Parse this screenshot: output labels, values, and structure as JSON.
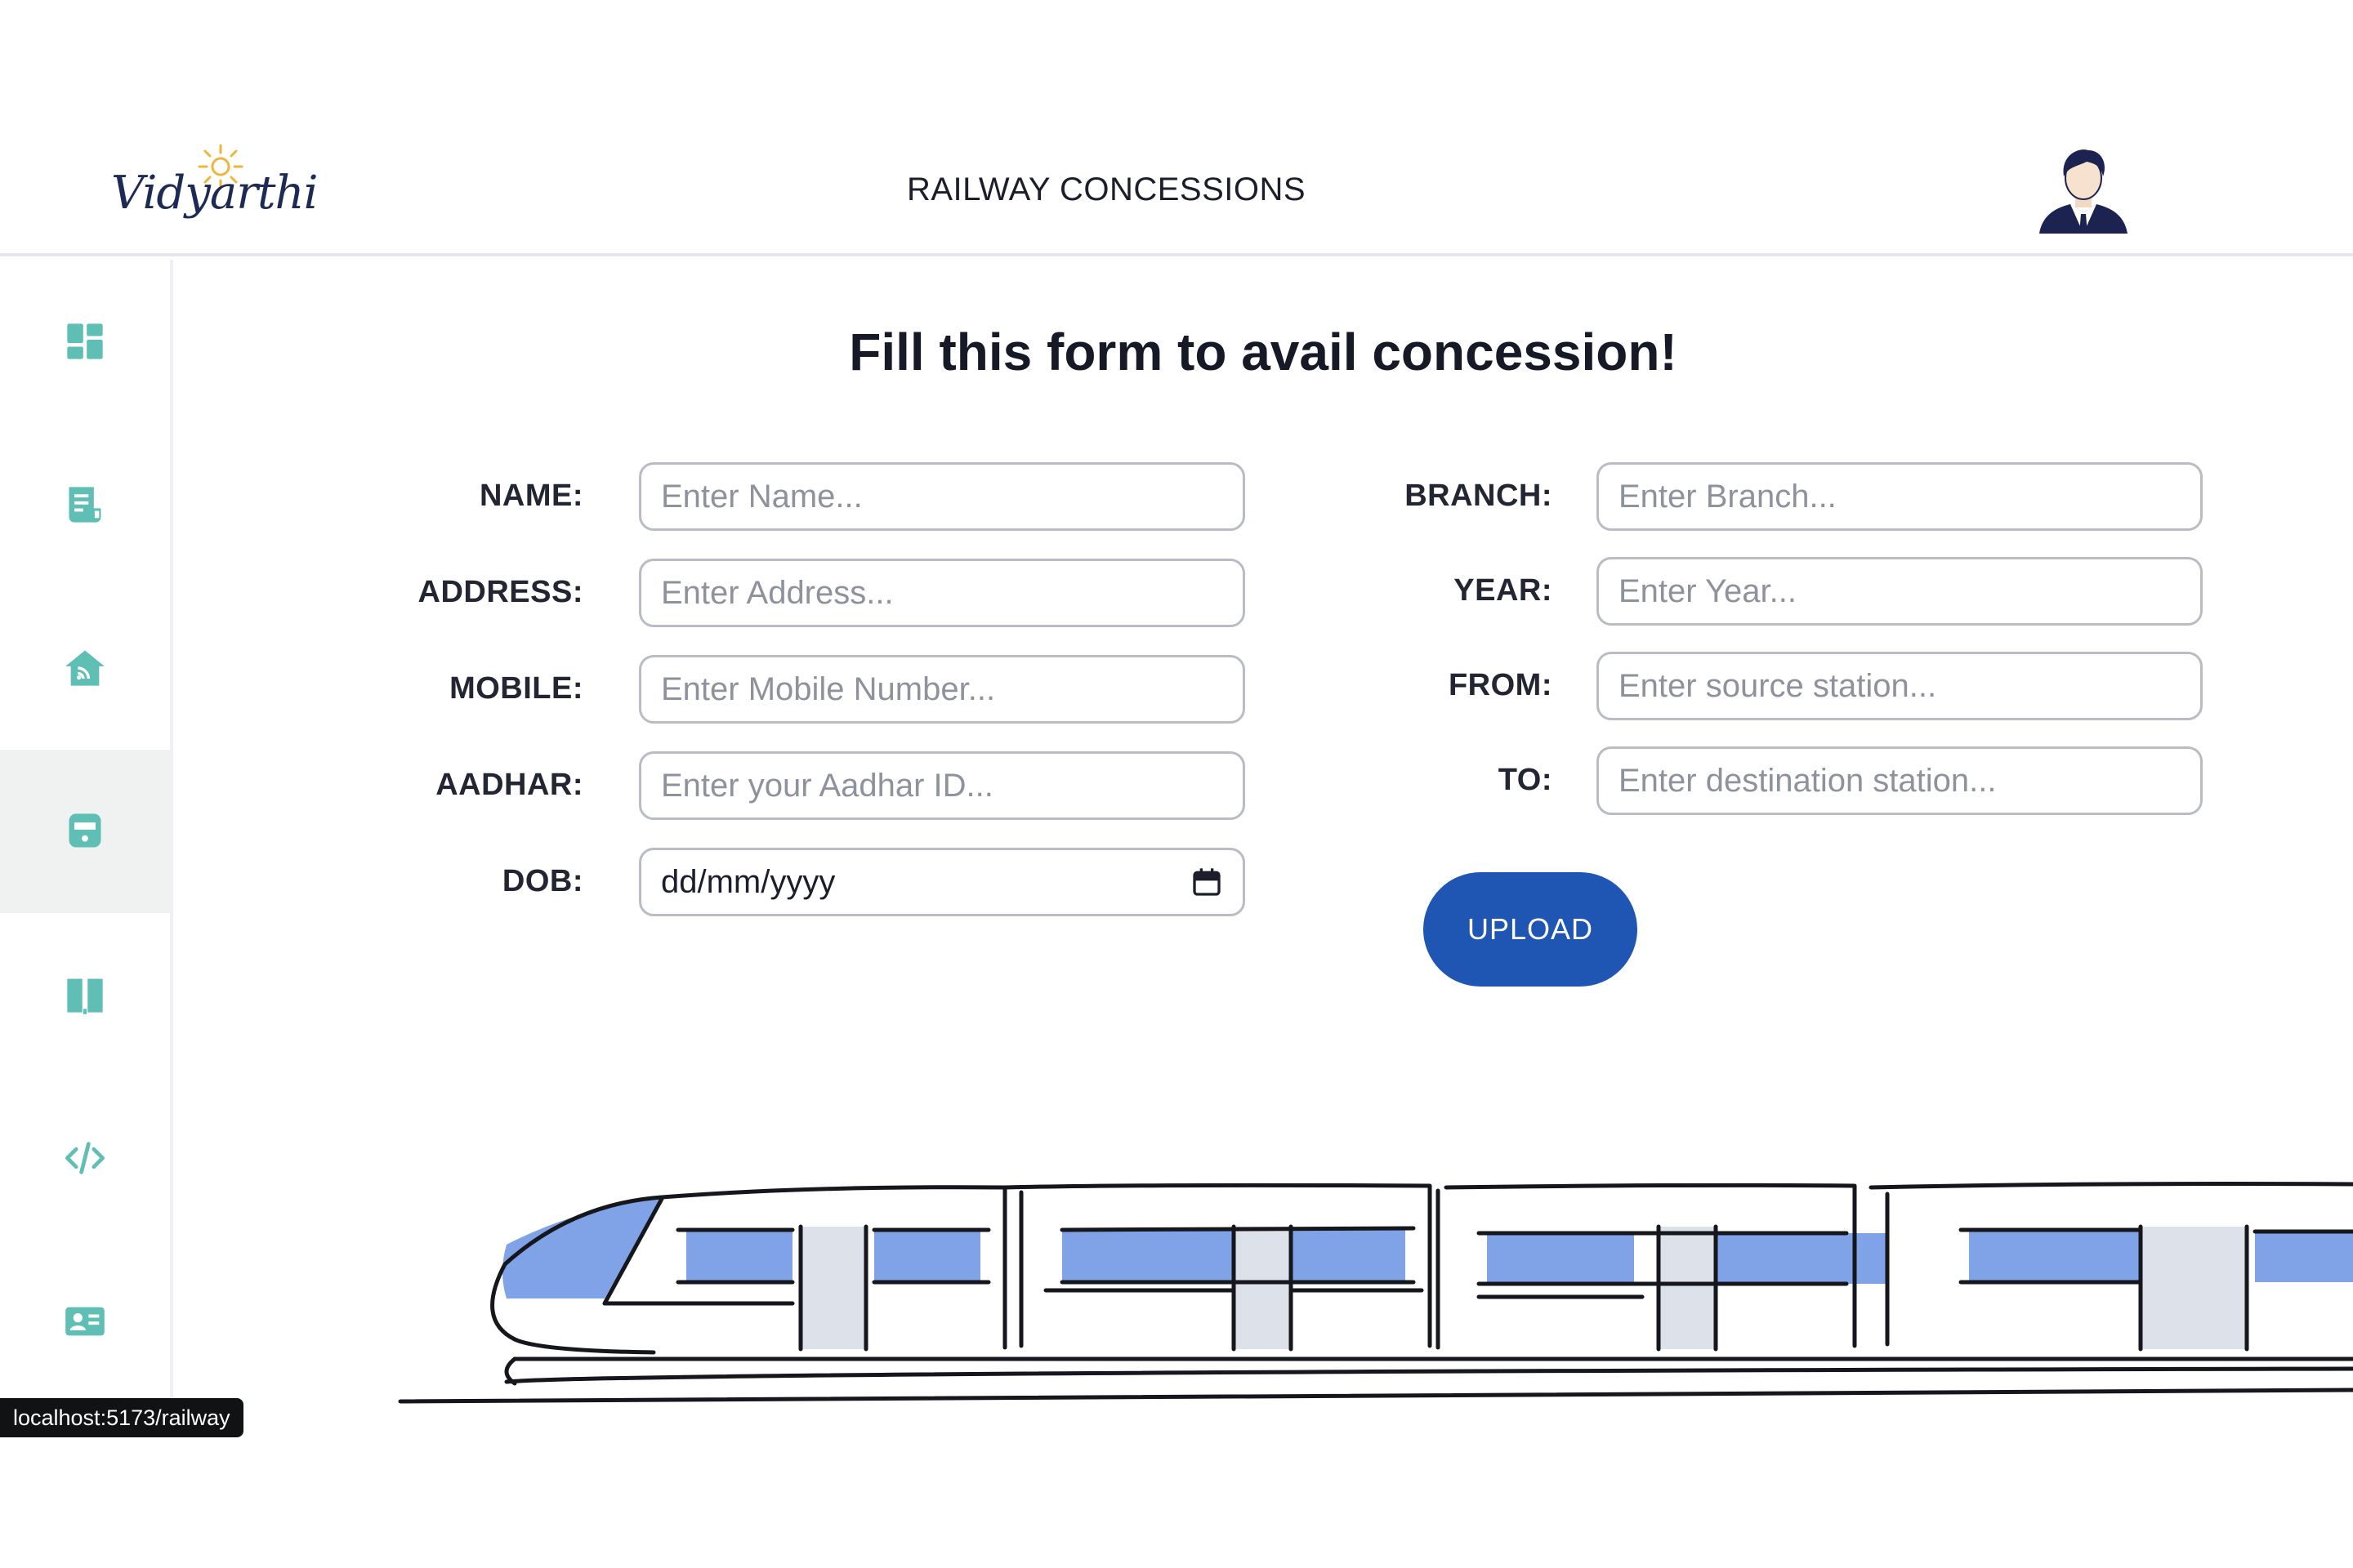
{
  "header": {
    "logo_text": "Vidyarthi",
    "title": "RAILWAY CONCESSIONS",
    "avatar_icon": "user-avatar-icon"
  },
  "sidebar": {
    "accent_color": "#5fbfb4",
    "items": [
      {
        "icon": "dashboard-icon",
        "active": false
      },
      {
        "icon": "document-icon",
        "active": false
      },
      {
        "icon": "home-icon",
        "active": false
      },
      {
        "icon": "train-icon",
        "active": true
      },
      {
        "icon": "book-icon",
        "active": false
      },
      {
        "icon": "code-icon",
        "active": false
      },
      {
        "icon": "id-card-icon",
        "active": false
      }
    ]
  },
  "form": {
    "heading": "Fill this form to avail concession!",
    "fields": {
      "name": {
        "label": "NAME:",
        "placeholder": "Enter Name..."
      },
      "address": {
        "label": "ADDRESS:",
        "placeholder": "Enter Address..."
      },
      "mobile": {
        "label": "MOBILE:",
        "placeholder": "Enter Mobile Number..."
      },
      "aadhar": {
        "label": "AADHAR:",
        "placeholder": "Enter your Aadhar ID..."
      },
      "dob": {
        "label": "DOB:",
        "value": "dd/mm/yyyy"
      },
      "branch": {
        "label": "BRANCH:",
        "placeholder": "Enter Branch..."
      },
      "year": {
        "label": "YEAR:",
        "placeholder": "Enter Year..."
      },
      "from": {
        "label": "FROM:",
        "placeholder": "Enter source station..."
      },
      "to": {
        "label": "TO:",
        "placeholder": "Enter destination station..."
      }
    },
    "upload_label": "UPLOAD",
    "button_color": "#1f56b4"
  },
  "status_bar": {
    "url": "localhost:5173/railway"
  }
}
